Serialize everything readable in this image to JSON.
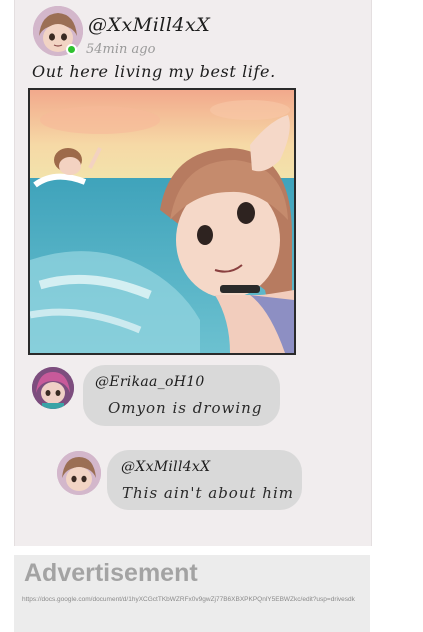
{
  "post": {
    "username": "@XxMill4xX",
    "time_ago": "54min ago",
    "caption": "Out here living my best life."
  },
  "comments": [
    {
      "username": "@Erikaa_oH10",
      "text": "Omyon is drowing"
    },
    {
      "username": "@XxMill4xX",
      "text": "This ain't about him"
    }
  ],
  "advertisement": {
    "title": "Advertisement",
    "link": "https://docs.google.com/document/d/1hyXCGctTKbWZRFx0v9gwZj77B6XBXPKPQnlY5EBWZkc/edit?usp=drivesdk"
  },
  "colors": {
    "online_indicator": "#2fc12f",
    "bubble": "#d9d9d9",
    "panel": "#f1edee"
  },
  "icons": [
    "online-status-icon"
  ]
}
